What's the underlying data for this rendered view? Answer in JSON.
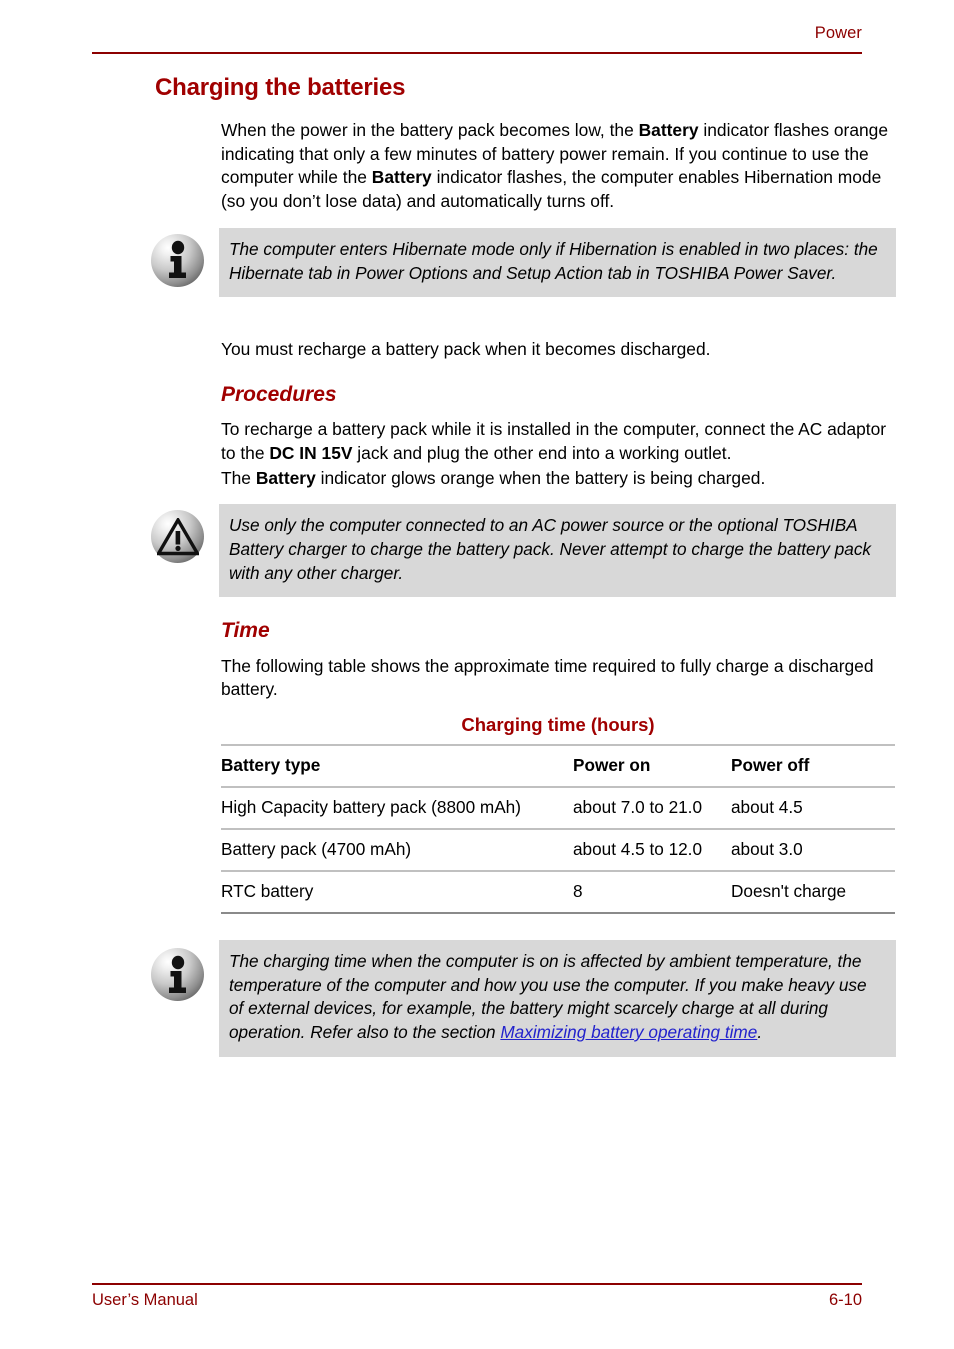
{
  "header": {
    "running_head": "Power"
  },
  "footer": {
    "manual_label": "User’s Manual",
    "page_number": "6-10"
  },
  "colors": {
    "heading_red": "#a00000",
    "rule_red": "#8c0000",
    "note_background": "#d8d8d8",
    "link_blue": "#2222cc",
    "table_rule": "#c0c0c0"
  },
  "main": {
    "section_title": "Charging the batteries",
    "intro_paragraph": {
      "part1": "When the power in the battery pack becomes low, the ",
      "bold1": "Battery",
      "part2": " indicator flashes orange indicating that only a few minutes of battery power remain. If you continue to use the computer while the ",
      "bold2": "Battery",
      "part3": " indicator flashes, the computer enables Hibernation mode (so you don’t lose data) and automatically turns off."
    },
    "note1": {
      "icon": "info-icon",
      "text": "The computer enters Hibernate mode only if Hibernation is enabled in two places: the Hibernate tab in Power Options and Setup Action tab in TOSHIBA Power Saver."
    },
    "recharge_paragraph": "You must recharge a battery pack when it becomes discharged.",
    "procedures": {
      "title": "Procedures",
      "paragraph": {
        "part1": "To recharge a battery pack while it is installed in the computer, connect the AC adaptor to the ",
        "bold1": "DC IN 15V",
        "part2": " jack and plug the other end into a working outlet."
      },
      "indicator_paragraph": {
        "part1": "The ",
        "bold1": "Battery",
        "part2": " indicator glows orange when the battery is being charged."
      }
    },
    "caution": {
      "icon": "caution-icon",
      "text": "Use only the computer connected to an AC power source or the optional TOSHIBA Battery charger to charge the battery pack. Never attempt to charge the battery pack with any other charger."
    },
    "time": {
      "title": "Time",
      "paragraph": "The following table shows the approximate time required to fully charge a discharged battery.",
      "table": {
        "caption": "Charging time (hours)",
        "columns": [
          "Battery type",
          "Power on",
          "Power off"
        ],
        "rows": [
          [
            "High Capacity battery pack (8800 mAh)",
            "about 7.0 to 21.0",
            "about 4.5"
          ],
          [
            "Battery pack (4700 mAh)",
            "about 4.5 to 12.0",
            "about 3.0"
          ],
          [
            "RTC battery",
            "8",
            "Doesn't charge"
          ]
        ]
      }
    },
    "note2": {
      "icon": "info-icon",
      "text_before_link": "The charging time when the computer is on is affected by ambient temperature, the temperature of the computer and how you use the computer. If you make heavy use of external devices, for example, the battery might scarcely charge at all during operation. Refer also to the section ",
      "link_text": "Maximizing battery operating time",
      "text_after_link": "."
    }
  }
}
